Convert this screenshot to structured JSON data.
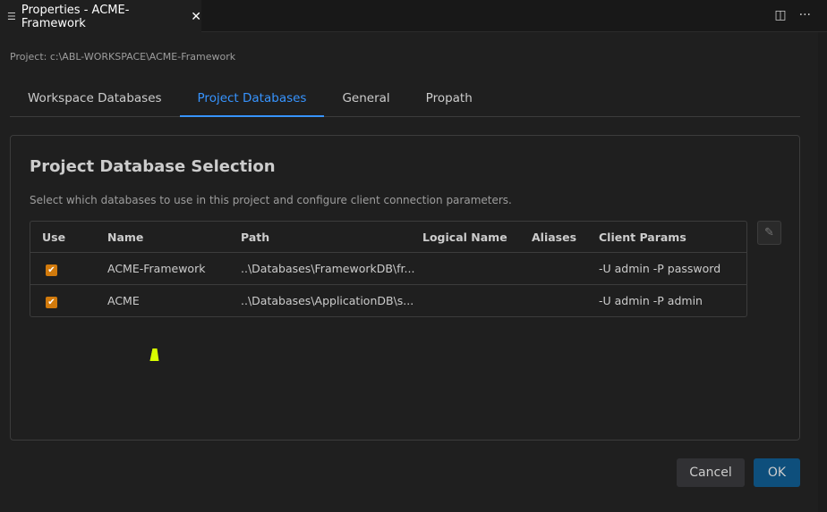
{
  "editor_tab": {
    "title": "Properties - ACME-Framework"
  },
  "project_path": "Project: c:\\ABL-WORKSPACE\\ACME-Framework",
  "tabs": [
    "Workspace Databases",
    "Project Databases",
    "General",
    "Propath"
  ],
  "active_tab": "Project Databases",
  "panel": {
    "title": "Project Database Selection",
    "description": "Select which databases to use in this project and configure client connection parameters."
  },
  "table": {
    "headers": [
      "Use",
      "Name",
      "Path",
      "Logical Name",
      "Aliases",
      "Client Params"
    ],
    "rows": [
      {
        "use": true,
        "name": "ACME-Framework",
        "path": "..\\Databases\\FrameworkDB\\fr...",
        "logical": "",
        "aliases": "",
        "params": "-U admin -P password"
      },
      {
        "use": true,
        "name": "ACME",
        "path": "..\\Databases\\ApplicationDB\\s...",
        "logical": "",
        "aliases": "",
        "params": "-U admin -P admin"
      }
    ]
  },
  "buttons": {
    "cancel": "Cancel",
    "ok": "OK"
  },
  "colors": {
    "accent": "#3794ff",
    "checkbox": "#d17a0c",
    "primary_button": "#0e4f7c"
  }
}
